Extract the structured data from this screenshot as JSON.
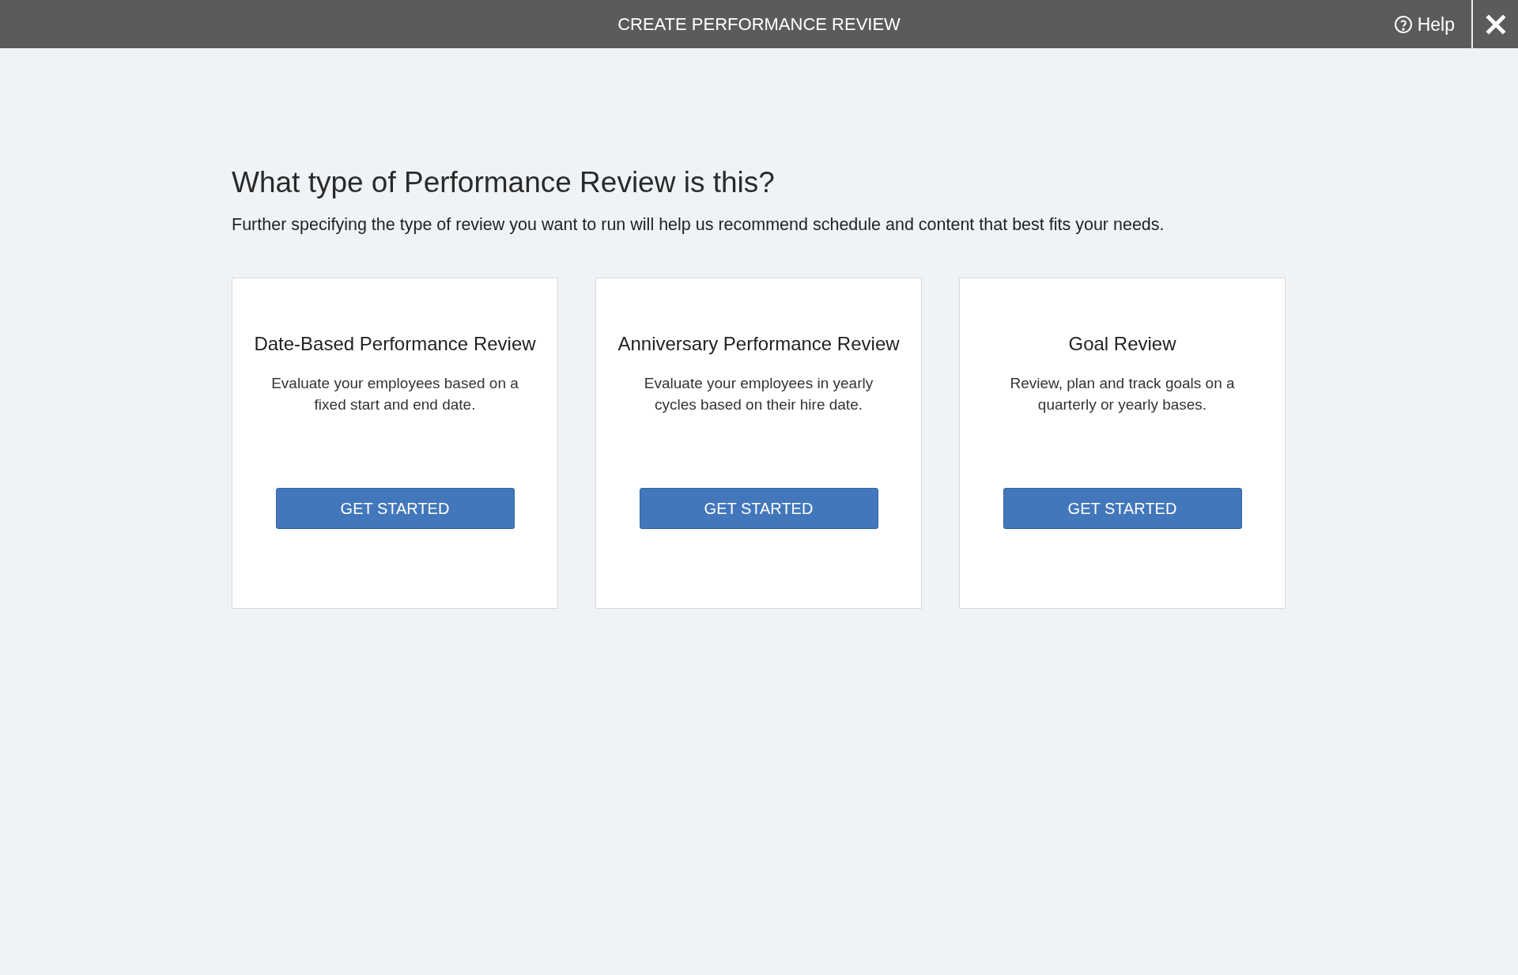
{
  "header": {
    "title": "CREATE PERFORMANCE REVIEW",
    "help": "Help"
  },
  "heading": "What type of Performance Review is this?",
  "subtitle": "Further specifying the type of review you want to run will help us recommend schedule and content that best fits your needs.",
  "cards": [
    {
      "title": "Date-Based Performance Review",
      "description": "Evaluate your employees based on a fixed start and end date.",
      "button": "GET STARTED"
    },
    {
      "title": "Anniversary Performance Review",
      "description": "Evaluate your employees in yearly cycles based on their hire date.",
      "button": "GET STARTED"
    },
    {
      "title": "Goal Review",
      "description": "Review, plan and track goals on a quarterly or yearly bases.",
      "button": "GET STARTED"
    }
  ]
}
